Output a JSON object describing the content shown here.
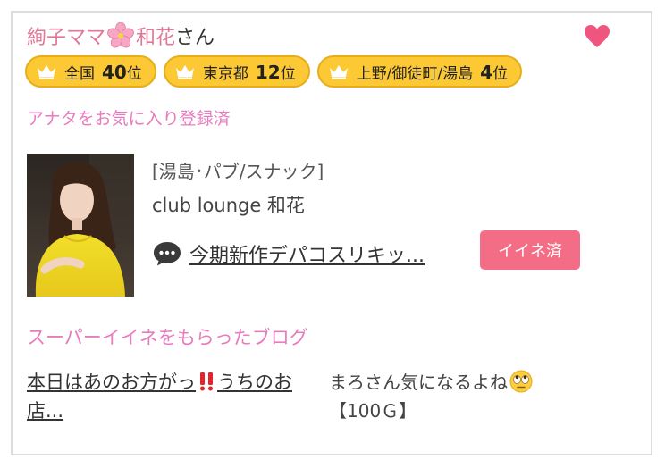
{
  "header": {
    "name_part1": "絢子ママ",
    "name_part2": "和花",
    "suffix": "さん",
    "flower_icon": "cherry-blossom-icon",
    "heart_icon": "heart-icon",
    "heart_color": "#f0557f"
  },
  "rankings": [
    {
      "area": "全国",
      "rank": "40",
      "unit": "位"
    },
    {
      "area": "東京都",
      "rank": "12",
      "unit": "位"
    },
    {
      "area": "上野/御徒町/湯島",
      "rank": "4",
      "unit": "位"
    }
  ],
  "favorite_status": "アナタをお気に入り登録済",
  "shop": {
    "category": "[湯島･パブ/スナック]",
    "name": "club lounge 和花"
  },
  "post": {
    "comment_icon": "speech-bubble-icon",
    "title": "今期新作デパコスリキッ...",
    "iine_button": "イイネ済"
  },
  "super_iine": {
    "section_title": "スーパーイイネをもらったブログ",
    "blog_title_a": "本日はあのお方がっ",
    "blog_title_b": "うちのお店...",
    "blog_title_icon": "double-exclamation-icon",
    "comment_text": "まろさん気になるよね",
    "comment_emoji": "rolling-eyes-emoji",
    "points": "【100Ｇ】"
  },
  "colors": {
    "name_pink": "#e07898",
    "label_pink": "#e87cbe",
    "rank_badge": "#fcc934",
    "button_pink": "#f26d85"
  }
}
